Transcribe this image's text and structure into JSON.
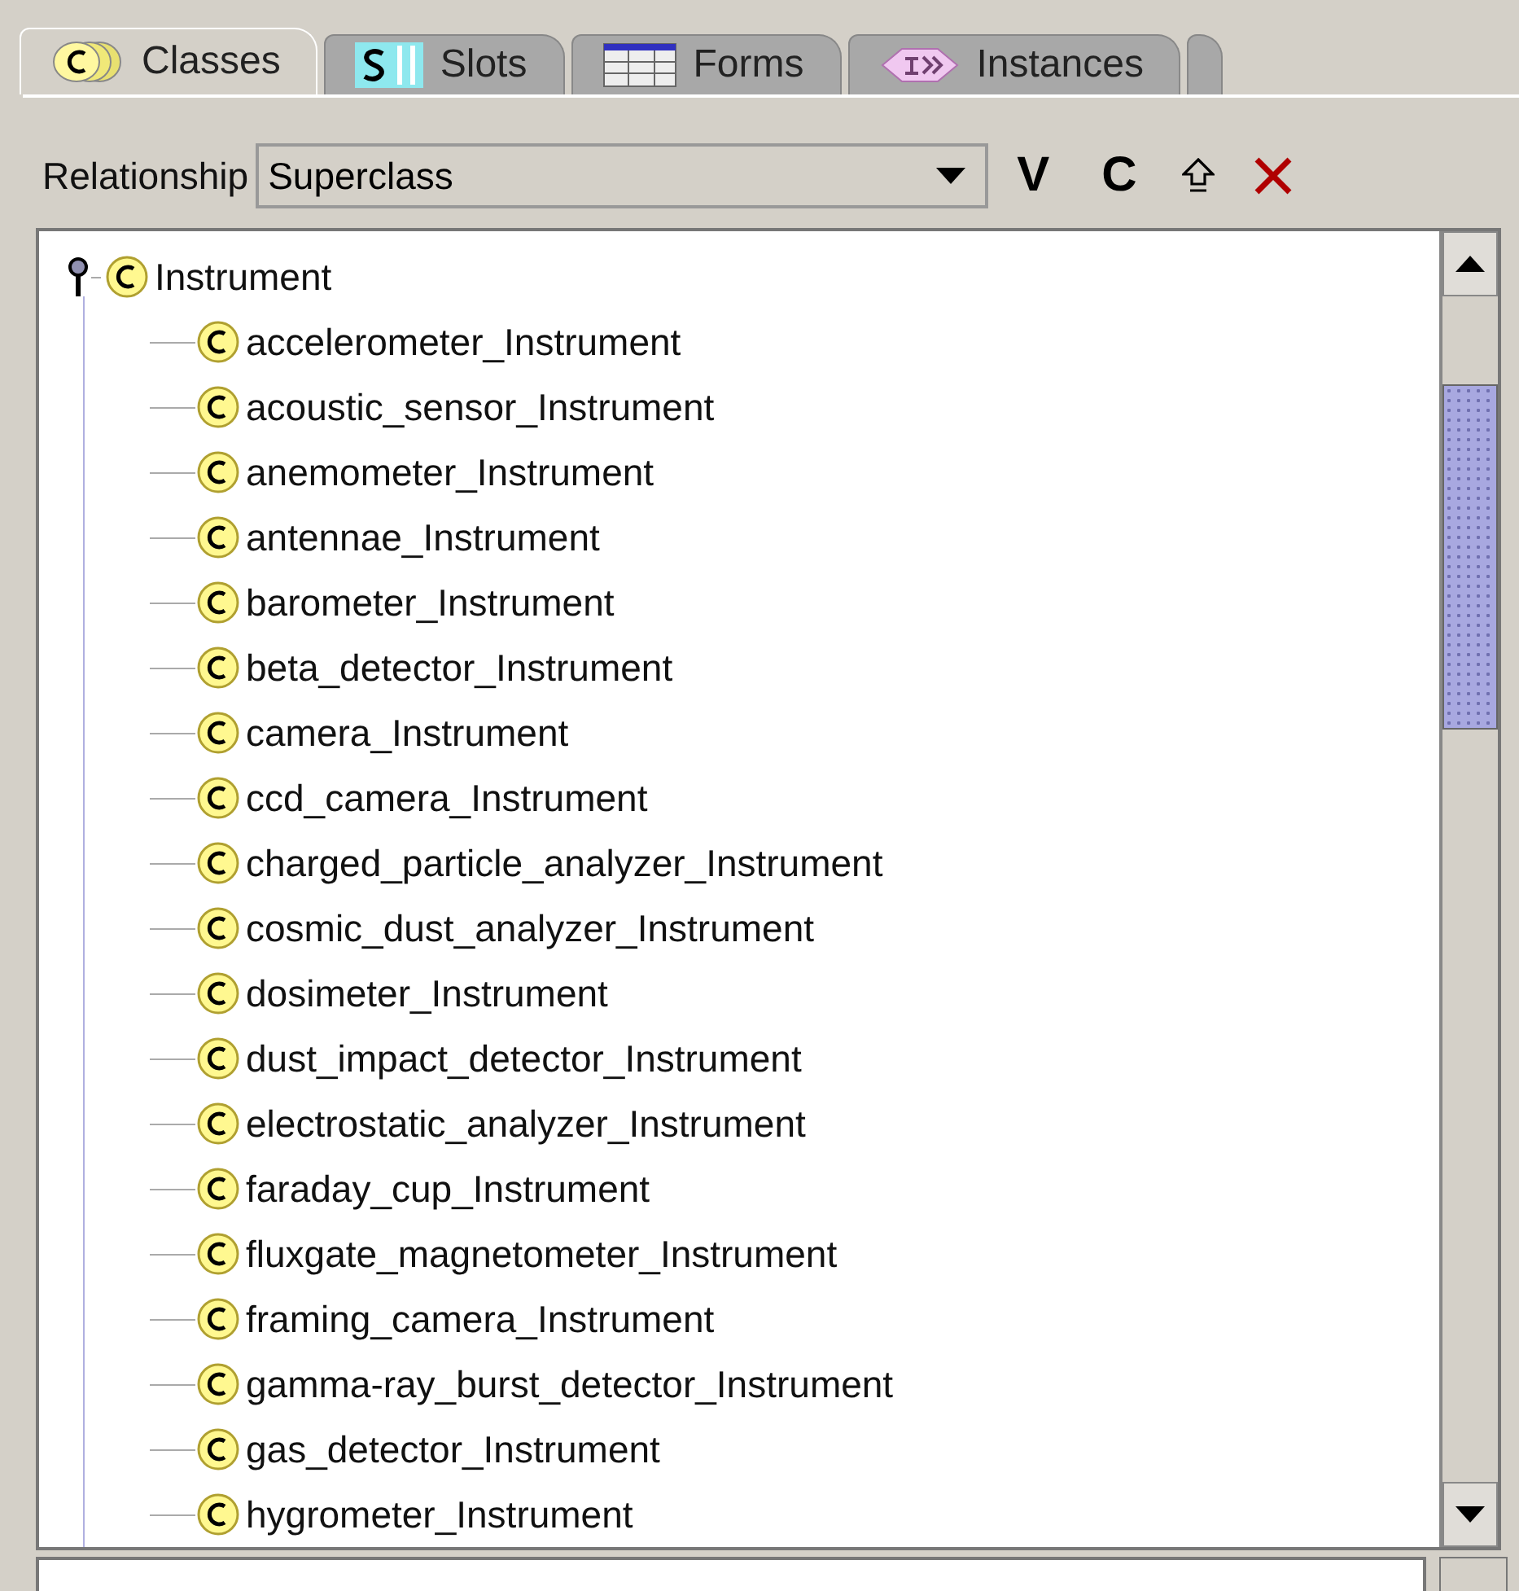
{
  "tabs": [
    {
      "label": "Classes",
      "kind": "classes",
      "selected": true
    },
    {
      "label": "Slots",
      "kind": "slots",
      "selected": false
    },
    {
      "label": "Forms",
      "kind": "forms",
      "selected": false
    },
    {
      "label": "Instances",
      "kind": "instances",
      "selected": false
    }
  ],
  "toolbar": {
    "label": "Relationship",
    "dropdown_value": "Superclass",
    "buttons": [
      {
        "kind": "text",
        "label": "V"
      },
      {
        "kind": "text",
        "label": "C"
      },
      {
        "kind": "up"
      },
      {
        "kind": "delete"
      }
    ]
  },
  "tree": {
    "root": {
      "label": "Instrument",
      "expanded": true,
      "children": [
        {
          "label": "accelerometer_Instrument"
        },
        {
          "label": "acoustic_sensor_Instrument"
        },
        {
          "label": "anemometer_Instrument"
        },
        {
          "label": "antennae_Instrument"
        },
        {
          "label": "barometer_Instrument"
        },
        {
          "label": "beta_detector_Instrument"
        },
        {
          "label": "camera_Instrument"
        },
        {
          "label": "ccd_camera_Instrument"
        },
        {
          "label": "charged_particle_analyzer_Instrument"
        },
        {
          "label": "cosmic_dust_analyzer_Instrument"
        },
        {
          "label": "dosimeter_Instrument"
        },
        {
          "label": "dust_impact_detector_Instrument"
        },
        {
          "label": "electrostatic_analyzer_Instrument"
        },
        {
          "label": "faraday_cup_Instrument"
        },
        {
          "label": "fluxgate_magnetometer_Instrument"
        },
        {
          "label": "framing_camera_Instrument"
        },
        {
          "label": "gamma-ray_burst_detector_Instrument"
        },
        {
          "label": "gas_detector_Instrument"
        },
        {
          "label": "hygrometer_Instrument"
        }
      ]
    }
  }
}
